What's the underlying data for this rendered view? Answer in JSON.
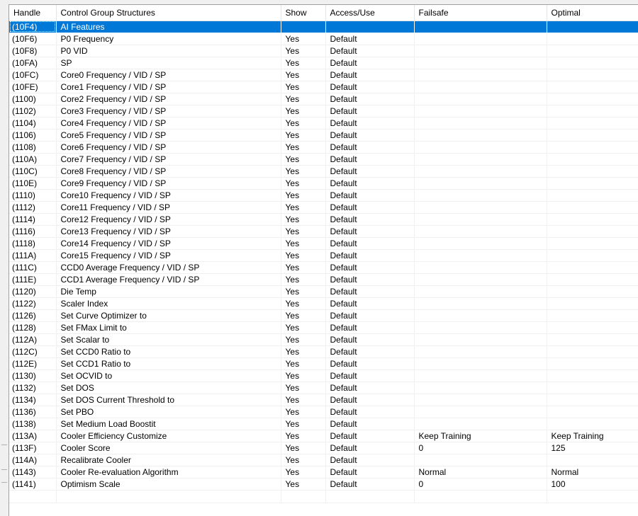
{
  "columns": [
    "Handle",
    "Control Group Structures",
    "Show",
    "Access/Use",
    "Failsafe",
    "Optimal"
  ],
  "rows": [
    {
      "handle": "(10F4)",
      "name": "AI Features",
      "show": "",
      "access": "",
      "failsafe": "",
      "optimal": "",
      "selected": true
    },
    {
      "handle": "(10F6)",
      "name": "P0 Frequency",
      "show": "Yes",
      "access": "Default",
      "failsafe": "",
      "optimal": ""
    },
    {
      "handle": "(10F8)",
      "name": "P0 VID",
      "show": "Yes",
      "access": "Default",
      "failsafe": "",
      "optimal": ""
    },
    {
      "handle": "(10FA)",
      "name": "SP",
      "show": "Yes",
      "access": "Default",
      "failsafe": "",
      "optimal": ""
    },
    {
      "handle": "(10FC)",
      "name": "Core0 Frequency / VID / SP",
      "show": "Yes",
      "access": "Default",
      "failsafe": "",
      "optimal": ""
    },
    {
      "handle": "(10FE)",
      "name": "Core1 Frequency / VID / SP",
      "show": "Yes",
      "access": "Default",
      "failsafe": "",
      "optimal": ""
    },
    {
      "handle": "(1100)",
      "name": "Core2 Frequency / VID / SP",
      "show": "Yes",
      "access": "Default",
      "failsafe": "",
      "optimal": ""
    },
    {
      "handle": "(1102)",
      "name": "Core3 Frequency / VID / SP",
      "show": "Yes",
      "access": "Default",
      "failsafe": "",
      "optimal": ""
    },
    {
      "handle": "(1104)",
      "name": "Core4 Frequency / VID / SP",
      "show": "Yes",
      "access": "Default",
      "failsafe": "",
      "optimal": ""
    },
    {
      "handle": "(1106)",
      "name": "Core5 Frequency / VID / SP",
      "show": "Yes",
      "access": "Default",
      "failsafe": "",
      "optimal": ""
    },
    {
      "handle": "(1108)",
      "name": "Core6 Frequency / VID / SP",
      "show": "Yes",
      "access": "Default",
      "failsafe": "",
      "optimal": ""
    },
    {
      "handle": "(110A)",
      "name": "Core7 Frequency / VID / SP",
      "show": "Yes",
      "access": "Default",
      "failsafe": "",
      "optimal": ""
    },
    {
      "handle": "(110C)",
      "name": "Core8 Frequency / VID / SP",
      "show": "Yes",
      "access": "Default",
      "failsafe": "",
      "optimal": ""
    },
    {
      "handle": "(110E)",
      "name": "Core9 Frequency / VID / SP",
      "show": "Yes",
      "access": "Default",
      "failsafe": "",
      "optimal": ""
    },
    {
      "handle": "(1110)",
      "name": "Core10 Frequency / VID / SP",
      "show": "Yes",
      "access": "Default",
      "failsafe": "",
      "optimal": ""
    },
    {
      "handle": "(1112)",
      "name": "Core11 Frequency / VID / SP",
      "show": "Yes",
      "access": "Default",
      "failsafe": "",
      "optimal": ""
    },
    {
      "handle": "(1114)",
      "name": "Core12 Frequency / VID / SP",
      "show": "Yes",
      "access": "Default",
      "failsafe": "",
      "optimal": ""
    },
    {
      "handle": "(1116)",
      "name": "Core13 Frequency / VID / SP",
      "show": "Yes",
      "access": "Default",
      "failsafe": "",
      "optimal": ""
    },
    {
      "handle": "(1118)",
      "name": "Core14 Frequency / VID / SP",
      "show": "Yes",
      "access": "Default",
      "failsafe": "",
      "optimal": ""
    },
    {
      "handle": "(111A)",
      "name": "Core15 Frequency / VID / SP",
      "show": "Yes",
      "access": "Default",
      "failsafe": "",
      "optimal": ""
    },
    {
      "handle": "(111C)",
      "name": "CCD0 Average Frequency / VID / SP",
      "show": "Yes",
      "access": "Default",
      "failsafe": "",
      "optimal": ""
    },
    {
      "handle": "(111E)",
      "name": "CCD1 Average Frequency / VID / SP",
      "show": "Yes",
      "access": "Default",
      "failsafe": "",
      "optimal": ""
    },
    {
      "handle": "(1120)",
      "name": "Die Temp",
      "show": "Yes",
      "access": "Default",
      "failsafe": "",
      "optimal": ""
    },
    {
      "handle": "(1122)",
      "name": "Scaler Index",
      "show": "Yes",
      "access": "Default",
      "failsafe": "",
      "optimal": ""
    },
    {
      "handle": "(1126)",
      "name": "Set Curve Optimizer to",
      "show": "Yes",
      "access": "Default",
      "failsafe": "",
      "optimal": ""
    },
    {
      "handle": "(1128)",
      "name": "Set FMax Limit to",
      "show": "Yes",
      "access": "Default",
      "failsafe": "",
      "optimal": ""
    },
    {
      "handle": "(112A)",
      "name": "Set Scalar to",
      "show": "Yes",
      "access": "Default",
      "failsafe": "",
      "optimal": ""
    },
    {
      "handle": "(112C)",
      "name": "Set CCD0 Ratio to",
      "show": "Yes",
      "access": "Default",
      "failsafe": "",
      "optimal": ""
    },
    {
      "handle": "(112E)",
      "name": "Set CCD1 Ratio to",
      "show": "Yes",
      "access": "Default",
      "failsafe": "",
      "optimal": ""
    },
    {
      "handle": "(1130)",
      "name": "Set OCVID to",
      "show": "Yes",
      "access": "Default",
      "failsafe": "",
      "optimal": ""
    },
    {
      "handle": "(1132)",
      "name": "Set DOS",
      "show": "Yes",
      "access": "Default",
      "failsafe": "",
      "optimal": ""
    },
    {
      "handle": "(1134)",
      "name": "Set DOS Current Threshold to",
      "show": "Yes",
      "access": "Default",
      "failsafe": "",
      "optimal": ""
    },
    {
      "handle": "(1136)",
      "name": "Set PBO",
      "show": "Yes",
      "access": "Default",
      "failsafe": "",
      "optimal": ""
    },
    {
      "handle": "(1138)",
      "name": "Set Medium Load Boostit",
      "show": "Yes",
      "access": "Default",
      "failsafe": "",
      "optimal": ""
    },
    {
      "handle": "(113A)",
      "name": "Cooler Efficiency Customize",
      "show": "Yes",
      "access": "Default",
      "failsafe": "Keep Training",
      "optimal": "Keep Training"
    },
    {
      "handle": "(113F)",
      "name": "Cooler Score",
      "show": "Yes",
      "access": "Default",
      "failsafe": "0",
      "optimal": "125"
    },
    {
      "handle": "(114A)",
      "name": "Recalibrate Cooler",
      "show": "Yes",
      "access": "Default",
      "failsafe": "",
      "optimal": ""
    },
    {
      "handle": "(1143)",
      "name": "Cooler Re-evaluation Algorithm",
      "show": "Yes",
      "access": "Default",
      "failsafe": "Normal",
      "optimal": "Normal"
    },
    {
      "handle": "(1141)",
      "name": "Optimism Scale",
      "show": "Yes",
      "access": "Default",
      "failsafe": "0",
      "optimal": "100"
    }
  ],
  "colors": {
    "selection": "#0078d7",
    "gridline": "#f0f0f0",
    "header_border": "#e5e5e5"
  }
}
